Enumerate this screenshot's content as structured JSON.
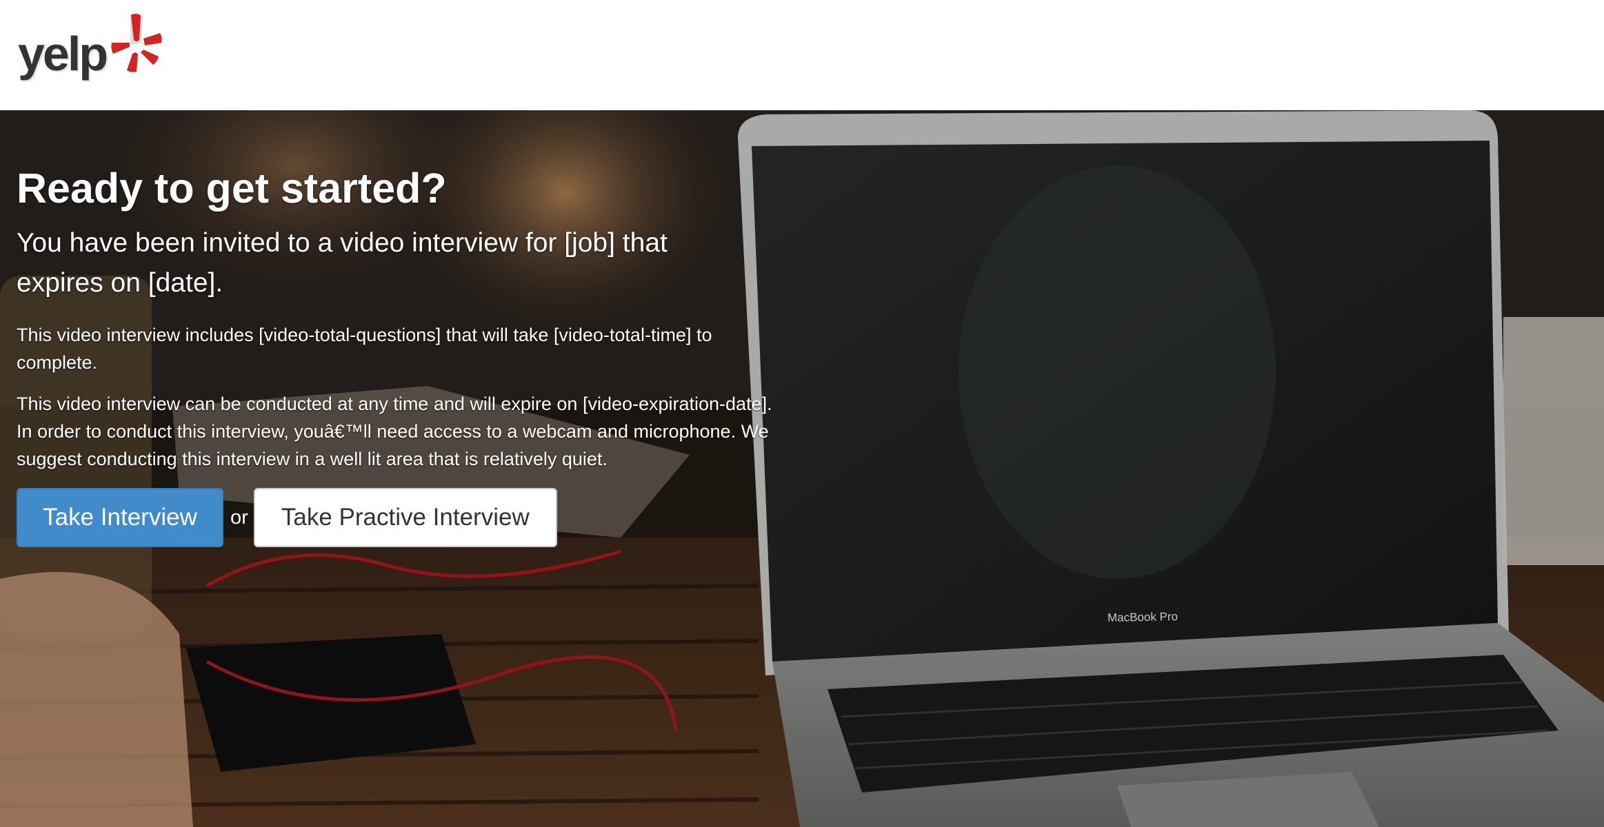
{
  "brand": {
    "logo_text": "yelp",
    "logo_icon": "yelp-burst-icon",
    "accent_color": "#d32323"
  },
  "hero": {
    "headline": "Ready to get started?",
    "subhead": "You have been invited to a video interview for [job] that expires on [date].",
    "paragraph1": "This video interview includes [video-total-questions] that will take [video-total-time] to complete.",
    "paragraph2": "This video interview can be conducted at any time and will expire on [video-expiration-date]. In order to conduct this interview, youâ€™ll need access to a webcam and microphone. We suggest conducting this interview in a well lit area that is relatively quiet.",
    "laptop_label": "MacBook Pro"
  },
  "actions": {
    "primary_label": "Take Interview",
    "or_text": "or",
    "secondary_label": "Take Practive Interview",
    "primary_color": "#428bca"
  }
}
